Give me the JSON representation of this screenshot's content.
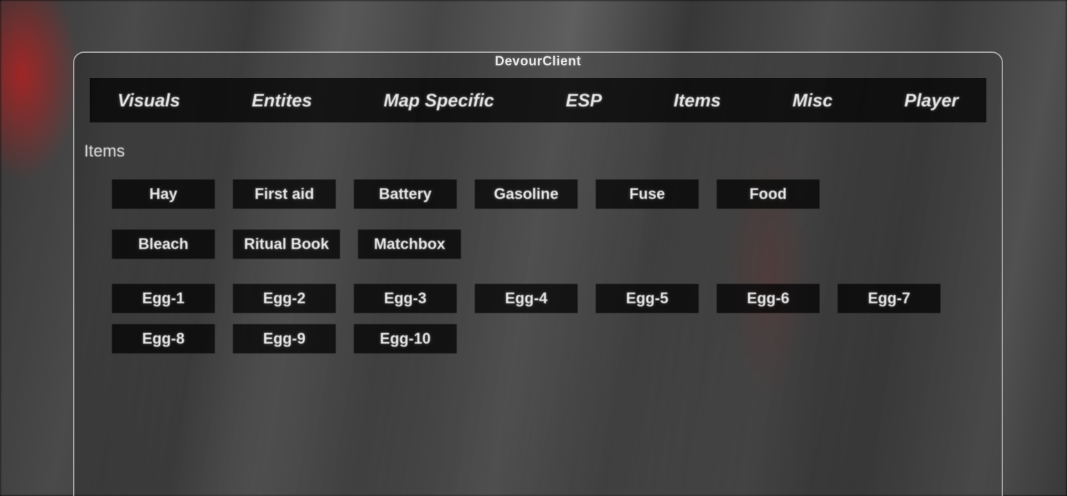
{
  "window": {
    "title": "DevourClient"
  },
  "tabs": [
    {
      "label": "Visuals"
    },
    {
      "label": "Entites"
    },
    {
      "label": "Map Specific"
    },
    {
      "label": "ESP"
    },
    {
      "label": "Items"
    },
    {
      "label": "Misc"
    },
    {
      "label": "Player"
    }
  ],
  "section": {
    "title": "Items"
  },
  "rows": {
    "r1": [
      "Hay",
      "First aid",
      "Battery",
      "Gasoline",
      "Fuse",
      "Food"
    ],
    "r2": [
      "Bleach",
      "Ritual Book",
      "Matchbox"
    ],
    "r3": [
      "Egg-1",
      "Egg-2",
      "Egg-3",
      "Egg-4",
      "Egg-5",
      "Egg-6",
      "Egg-7"
    ],
    "r4": [
      "Egg-8",
      "Egg-9",
      "Egg-10"
    ]
  }
}
